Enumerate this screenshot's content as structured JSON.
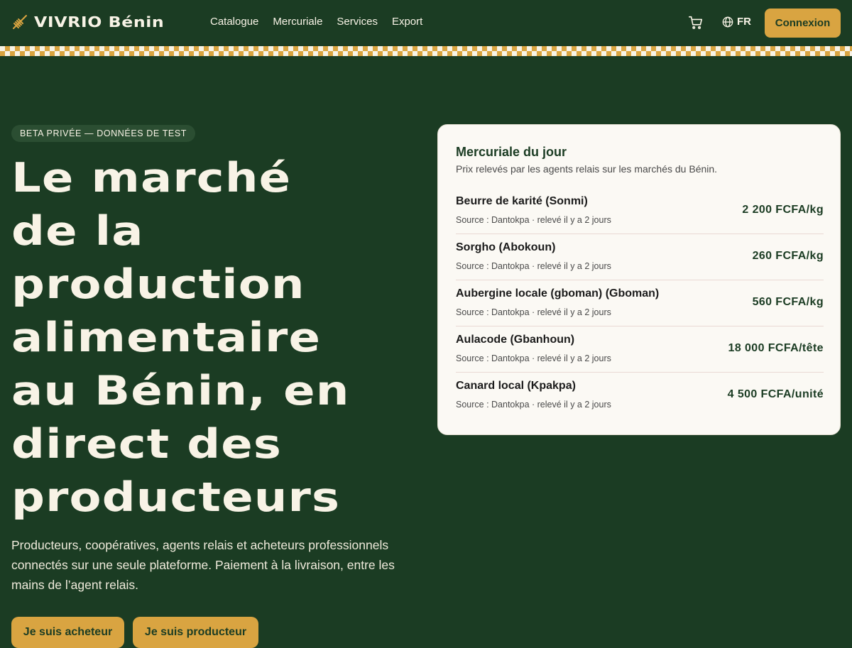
{
  "header": {
    "brand": "VIVRIO Bénin",
    "nav": [
      "Catalogue",
      "Mercuriale",
      "Services",
      "Export"
    ],
    "lang": "FR",
    "login_label": "Connexion"
  },
  "hero": {
    "badge": "BETA PRIVÉE — DONNÉES DE TEST",
    "title_lines": [
      "Le marché",
      "de la",
      "production",
      "alimentaire",
      "au Bénin, en",
      "direct des",
      "producteurs"
    ],
    "subtitle": "Producteurs, coopératives, agents relais et acheteurs professionnels connectés sur une seule plateforme. Paiement à la livraison, entre les mains de l’agent relais.",
    "buyer_label": "Je suis acheteur",
    "producer_label": "Je suis producteur"
  },
  "mercuriale": {
    "title": "Mercuriale du jour",
    "subtitle": "Prix relevés par les agents relais sur les marchés du Bénin.",
    "rows": [
      {
        "name": "Beurre de karité (Sonmi)",
        "source": "Source : Dantokpa · relevé il y a 2 jours",
        "price": "2 200 FCFA/kg"
      },
      {
        "name": "Sorgho (Abokoun)",
        "source": "Source : Dantokpa · relevé il y a 2 jours",
        "price": "260 FCFA/kg"
      },
      {
        "name": "Aubergine locale (gboman) (Gboman)",
        "source": "Source : Dantokpa · relevé il y a 2 jours",
        "price": "560 FCFA/kg"
      },
      {
        "name": "Aulacode (Gbanhoun)",
        "source": "Source : Dantokpa · relevé il y a 2 jours",
        "price": "18 000 FCFA/tête"
      },
      {
        "name": "Canard local (Kpakpa)",
        "source": "Source : Dantokpa · relevé il y a 2 jours",
        "price": "4 500 FCFA/unité"
      }
    ]
  },
  "colors": {
    "background": "#1b3c23",
    "accent": "#d9a441",
    "cream": "#f8f3e6"
  },
  "icons": [
    "wheat-logo-icon",
    "cart-icon",
    "globe-icon"
  ]
}
